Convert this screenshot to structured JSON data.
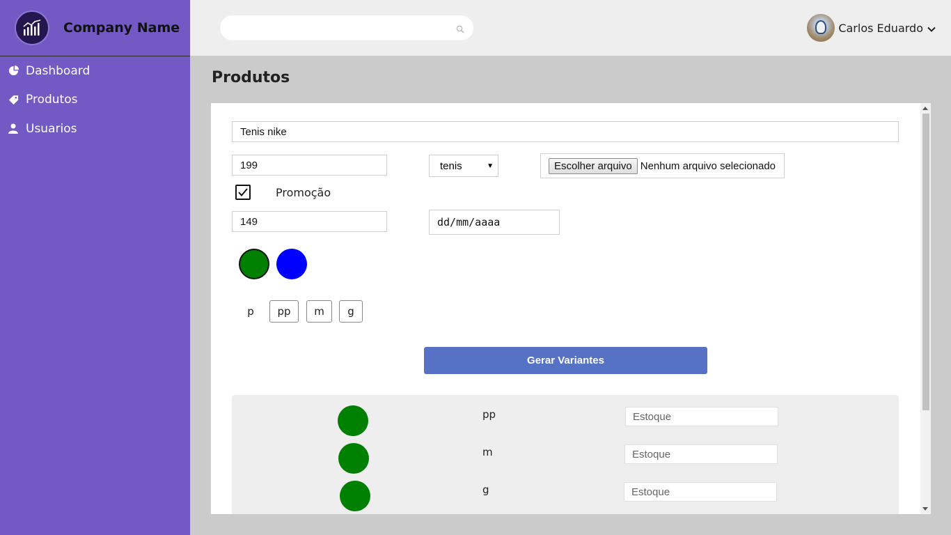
{
  "sidebar": {
    "brand": {
      "name": "Company Name",
      "logo_icon": "chart-bars-icon"
    },
    "items": [
      {
        "label": "Dashboard",
        "icon": "pie-chart-icon"
      },
      {
        "label": "Produtos",
        "icon": "tag-icon"
      },
      {
        "label": "Usuarios",
        "icon": "user-icon"
      }
    ]
  },
  "header": {
    "search": {
      "placeholder": "",
      "value": "",
      "icon": "search-icon"
    },
    "user": {
      "name": "Carlos Eduardo",
      "icon": "chevron-down-icon"
    }
  },
  "page": {
    "title": "Produtos"
  },
  "form": {
    "name_value": "Tenis nike",
    "price_value": "199",
    "category_selected": "tenis",
    "file": {
      "button_label": "Escolher arquivo",
      "status": "Nenhum arquivo selecionado"
    },
    "promo": {
      "label": "Promoção",
      "checked": true
    },
    "promo_price_value": "149",
    "date_placeholder": "dd/mm/aaaa",
    "colors": [
      "#008000",
      "#0000ff"
    ],
    "sizes": [
      "p",
      "pp",
      "m",
      "g"
    ],
    "generate_label": "Gerar Variantes"
  },
  "variants": [
    {
      "color": "#008000",
      "size": "pp",
      "stock_placeholder": "Estoque"
    },
    {
      "color": "#008000",
      "size": "m",
      "stock_placeholder": "Estoque"
    },
    {
      "color": "#008000",
      "size": "g",
      "stock_placeholder": "Estoque"
    }
  ],
  "colors": {
    "sidebar_bg": "#7359c4",
    "accent_button": "#5572c4",
    "content_bg": "#cbcbcb"
  }
}
